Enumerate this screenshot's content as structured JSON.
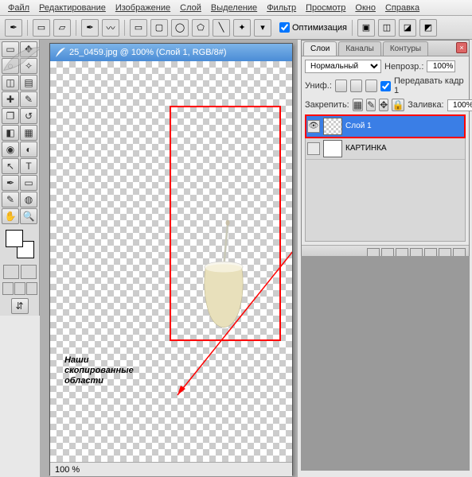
{
  "menu": {
    "items": [
      "Файл",
      "Редактирование",
      "Изображение",
      "Слой",
      "Выделение",
      "Фильтр",
      "Просмотр",
      "Окно",
      "Справка"
    ]
  },
  "optbar": {
    "optimize": "Оптимизация"
  },
  "doc": {
    "title": "25_0459.jpg @ 100% (Слой 1, RGB/8#)",
    "zoom": "100 %"
  },
  "annotation": {
    "l1": "Наши",
    "l2": "скопированные",
    "l3": "области"
  },
  "panel": {
    "tabs": {
      "layers": "Слои",
      "channels": "Каналы",
      "paths": "Контуры"
    },
    "blend": "Нормальный",
    "opacity_lbl": "Непрозр.:",
    "opacity_val": "100%",
    "unif_lbl": "Униф.:",
    "pass_frame": "Передавать кадр 1",
    "lock_lbl": "Закрепить:",
    "fill_lbl": "Заливка:",
    "fill_val": "100%",
    "layer1": "Слой 1",
    "layer2": "КАРТИНКА"
  }
}
